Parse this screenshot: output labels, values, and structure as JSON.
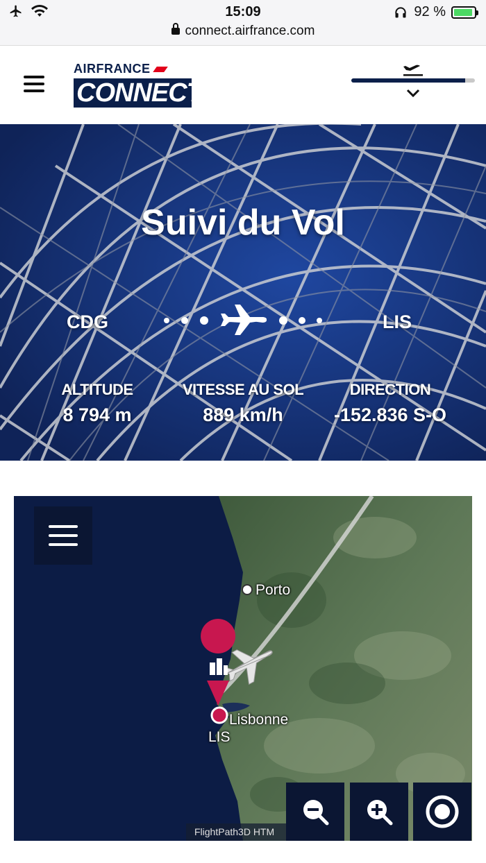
{
  "status_bar": {
    "time": "15:09",
    "battery_text": "92 %",
    "battery_level": 0.92,
    "url": "connect.airfrance.com"
  },
  "header": {
    "logo_top": "AIRFRANCE",
    "logo_bottom": "CONNECT",
    "flight_progress": 0.92
  },
  "hero": {
    "title": "Suivi du Vol",
    "origin": "CDG",
    "destination": "LIS",
    "stats": {
      "altitude_label": "ALTITUDE",
      "altitude_value": "8 794 m",
      "speed_label": "VITESSE AU SOL",
      "speed_value": "889 km/h",
      "direction_label": "DIRECTION",
      "direction_value": "-152.836 S-O"
    }
  },
  "map": {
    "cities": {
      "porto": "Porto",
      "lisbonne": "Lisbonne",
      "lis_code": "LIS"
    },
    "attribution": "FlightPath3D HTM",
    "colors": {
      "ocean": "#0c1c45",
      "land": "#4e6a4a",
      "pin": "#c8174f",
      "flight_path": "#d8d8d8"
    }
  },
  "colors": {
    "brand_navy": "#0b1f4a",
    "brand_red": "#e2001a",
    "battery_green": "#4cd964"
  }
}
